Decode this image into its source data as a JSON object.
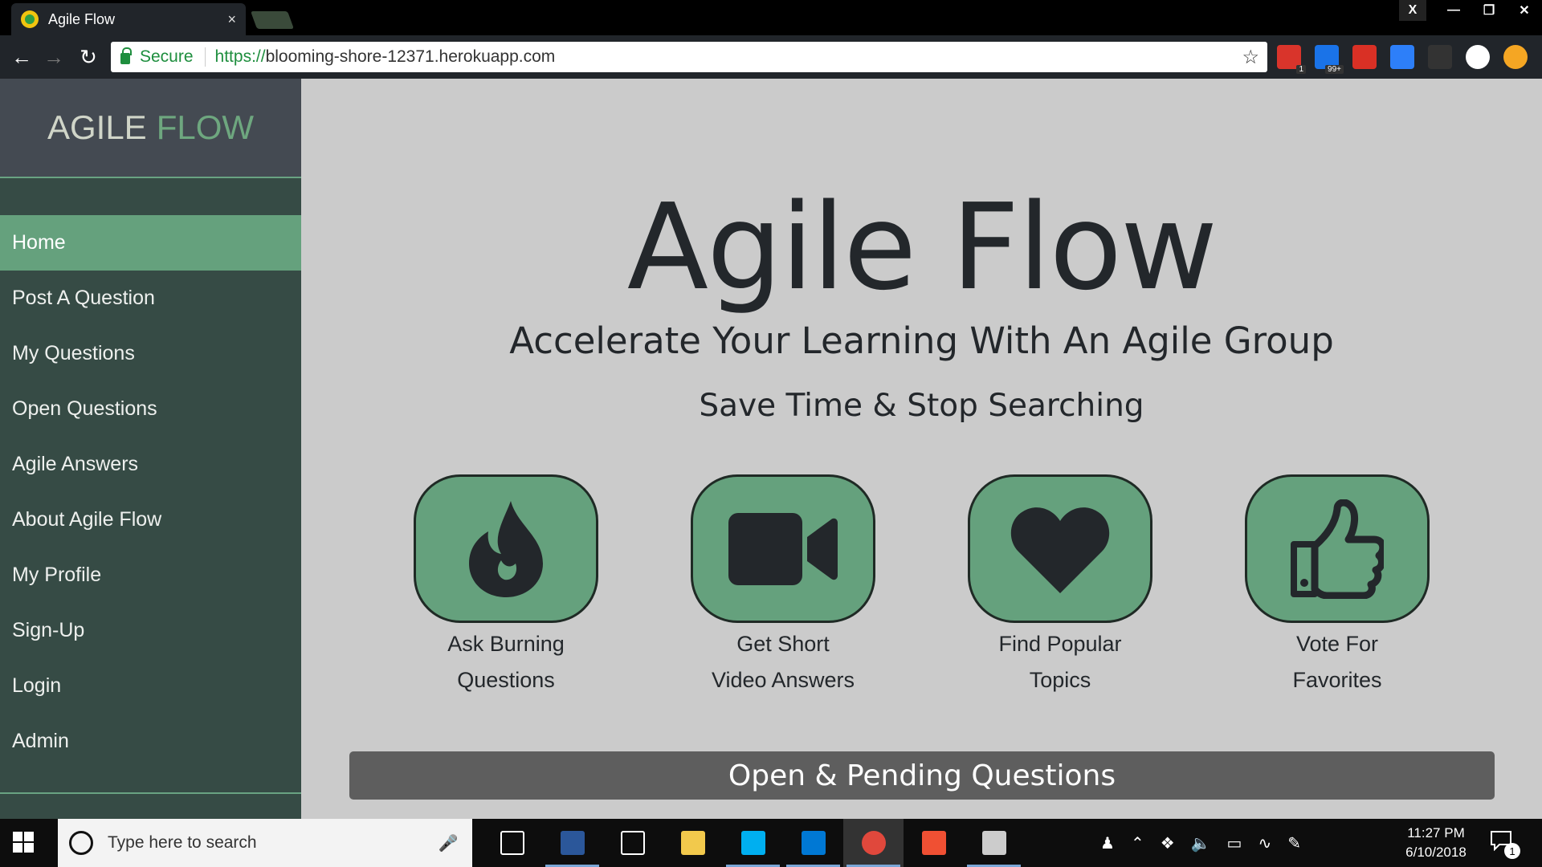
{
  "browser": {
    "tab_title": "Agile Flow",
    "tab_close": "×",
    "ext_close_label": "X",
    "security_label": "Secure",
    "url_scheme": "https://",
    "url_host": "blooming-shore-12371.herokuapp.com",
    "extensions": [
      {
        "icon": "todoist-extension-icon",
        "color": "#d9342b",
        "badge": "1"
      },
      {
        "icon": "mail-checker-extension-icon",
        "color": "#1a73e8",
        "badge": "99+"
      },
      {
        "icon": "bookmark-extension-icon",
        "color": "#d93025",
        "badge": ""
      },
      {
        "icon": "layers-extension-icon",
        "color": "#2d7ff9",
        "badge": ""
      },
      {
        "icon": "pen-extension-icon",
        "color": "#333333",
        "badge": ""
      },
      {
        "icon": "circle-extension-icon",
        "color": "#ffffff",
        "badge": ""
      },
      {
        "icon": "account-extension-icon",
        "color": "#f5a623",
        "badge": ""
      }
    ]
  },
  "sidebar": {
    "brand_first": "AGILE",
    "brand_second": "FLOW",
    "items": [
      {
        "label": "Home",
        "active": true
      },
      {
        "label": "Post A Question",
        "active": false
      },
      {
        "label": "My Questions",
        "active": false
      },
      {
        "label": "Open Questions",
        "active": false
      },
      {
        "label": "Agile Answers",
        "active": false
      },
      {
        "label": "About Agile Flow",
        "active": false
      },
      {
        "label": "My Profile",
        "active": false
      },
      {
        "label": "Sign-Up",
        "active": false
      },
      {
        "label": "Login",
        "active": false
      },
      {
        "label": "Admin",
        "active": false
      }
    ]
  },
  "hero": {
    "title": "Agile Flow",
    "subtitle": "Accelerate Your Learning With An Agile Group",
    "tagline": "Save Time & Stop Searching"
  },
  "features": [
    {
      "icon": "fire-icon",
      "line1": "Ask Burning",
      "line2": "Questions"
    },
    {
      "icon": "video-camera-icon",
      "line1": "Get Short",
      "line2": "Video Answers"
    },
    {
      "icon": "heart-icon",
      "line1": "Find Popular",
      "line2": "Topics"
    },
    {
      "icon": "thumbs-up-icon",
      "line1": "Vote For",
      "line2": "Favorites"
    }
  ],
  "section": {
    "title": "Open & Pending Questions"
  },
  "taskbar": {
    "search_placeholder": "Type here to search",
    "time": "11:27 PM",
    "date": "6/10/2018",
    "notification_count": "1",
    "apps": [
      {
        "icon": "task-view-icon",
        "running": false
      },
      {
        "icon": "word-icon",
        "running": true
      },
      {
        "icon": "calculator-icon",
        "running": false
      },
      {
        "icon": "file-explorer-icon",
        "running": false
      },
      {
        "icon": "skype-icon",
        "running": true
      },
      {
        "icon": "vscode-icon",
        "running": true
      },
      {
        "icon": "chrome-icon",
        "running": true
      },
      {
        "icon": "git-icon",
        "running": false
      },
      {
        "icon": "terminal-icon",
        "running": true
      }
    ]
  },
  "colors": {
    "sidebar_bg": "#364b45",
    "accent_green": "#65a17d",
    "main_bg": "#cbcbcb",
    "text_dark": "#23272b"
  }
}
